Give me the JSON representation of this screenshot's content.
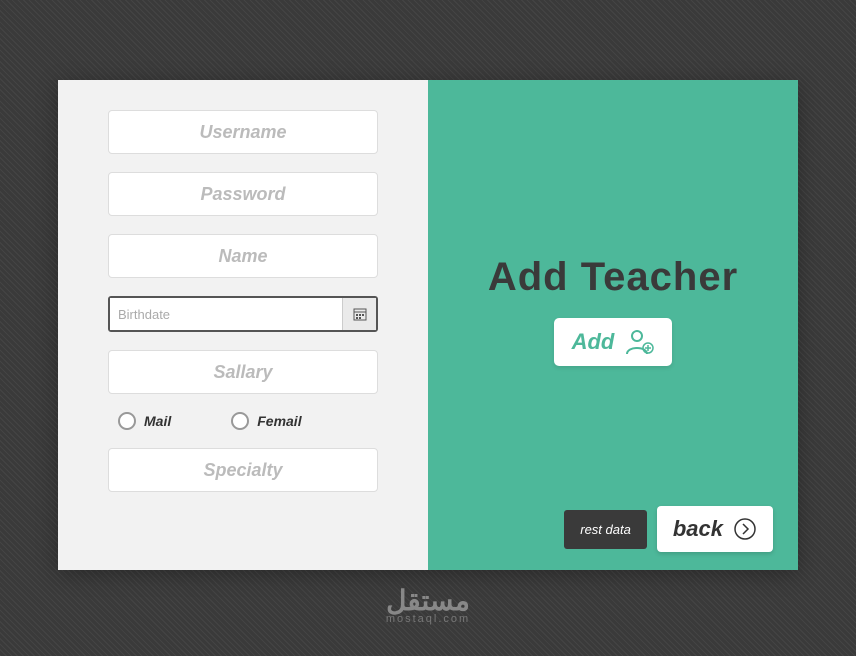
{
  "form": {
    "username_placeholder": "Username",
    "password_placeholder": "Password",
    "name_placeholder": "Name",
    "birthdate_placeholder": "Birthdate",
    "salary_placeholder": "Sallary",
    "specialty_placeholder": "Specialty",
    "gender": {
      "male_label": "Mail",
      "female_label": "Femail"
    }
  },
  "panel": {
    "title": "Add Teacher",
    "add_label": "Add",
    "rest_label": "rest data",
    "back_label": "back"
  },
  "footer": {
    "logo_arabic": "مستقل",
    "logo_sub": "mostaql.com"
  }
}
